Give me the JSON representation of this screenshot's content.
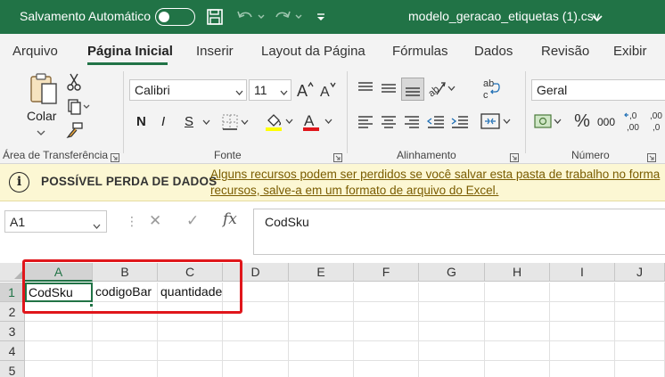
{
  "titlebar": {
    "autosave_label": "Salvamento Automático",
    "autosave_state": "off",
    "filename": "modelo_geracao_etiquetas (1).csv"
  },
  "menu": {
    "tabs": [
      "Arquivo",
      "Página Inicial",
      "Inserir",
      "Layout da Página",
      "Fórmulas",
      "Dados",
      "Revisão",
      "Exibir"
    ],
    "active": "Página Inicial"
  },
  "ribbon": {
    "clipboard": {
      "paste_label": "Colar",
      "group_label": "Área de Transferência"
    },
    "font": {
      "group_label": "Fonte",
      "font_name": "Calibri",
      "font_size": "11",
      "bold": "N",
      "italic": "I",
      "underline": "S",
      "highlight_color": "#ffff00",
      "font_color": "#e0161b"
    },
    "alignment": {
      "group_label": "Alinhamento"
    },
    "number": {
      "group_label": "Número",
      "format": "Geral",
      "thousands_label": "000"
    }
  },
  "warning": {
    "title": "POSSÍVEL PERDA DE DADOS",
    "message_line1": "Alguns recursos podem ser perdidos se você salvar esta pasta de trabalho no forma",
    "message_line2": "recursos, salve-a em um formato de arquivo do Excel."
  },
  "formula_bar": {
    "name_box": "A1",
    "fx_label": "fx",
    "formula": "CodSku"
  },
  "grid": {
    "columns": [
      "A",
      "B",
      "C",
      "D",
      "E",
      "F",
      "G",
      "H",
      "I",
      "J"
    ],
    "rows": [
      "1",
      "2",
      "3",
      "4",
      "5"
    ],
    "cells": {
      "A1": "CodSku",
      "B1": "codigoBar",
      "C1": "quantidade"
    },
    "active_cell": "A1",
    "accent_color": "#217346",
    "highlight_color": "#e0161b"
  }
}
